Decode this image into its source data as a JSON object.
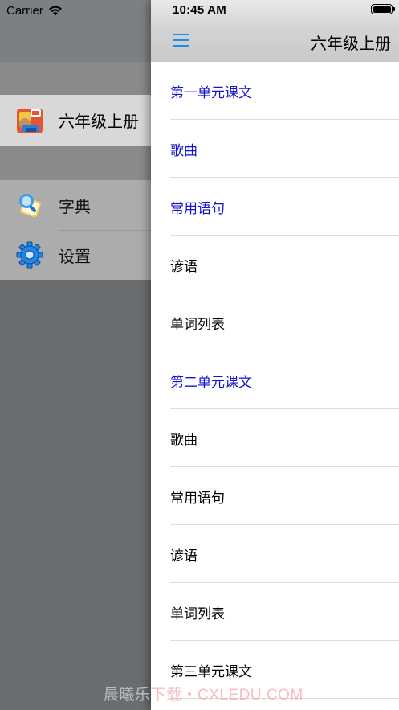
{
  "status_bar": {
    "carrier": "Carrier",
    "time": "10:45 AM",
    "battery_level": 1.0
  },
  "drawer": {
    "book": {
      "label": "六年级上册",
      "icon": "book-cover-icon"
    },
    "items": [
      {
        "label": "字典",
        "icon": "dictionary-icon"
      },
      {
        "label": "设置",
        "icon": "gear-icon"
      }
    ]
  },
  "navbar": {
    "title": "六年级上册",
    "menu_icon": "hamburger-menu-icon",
    "menu_color": "#1a8fe6"
  },
  "list": {
    "rows": [
      {
        "label": "第一单元课文",
        "highlight": true
      },
      {
        "label": "歌曲",
        "highlight": true
      },
      {
        "label": "常用语句",
        "highlight": true
      },
      {
        "label": "谚语",
        "highlight": false
      },
      {
        "label": "单词列表",
        "highlight": false
      },
      {
        "label": "第二单元课文",
        "highlight": true
      },
      {
        "label": "歌曲",
        "highlight": false
      },
      {
        "label": "常用语句",
        "highlight": false
      },
      {
        "label": "谚语",
        "highlight": false
      },
      {
        "label": "单词列表",
        "highlight": false
      },
      {
        "label": "第三单元课文",
        "highlight": false
      }
    ],
    "highlight_color": "#1414c8"
  },
  "watermark": {
    "part1": "晨曦乐",
    "part2": "下载・CXLEDU.COM"
  }
}
